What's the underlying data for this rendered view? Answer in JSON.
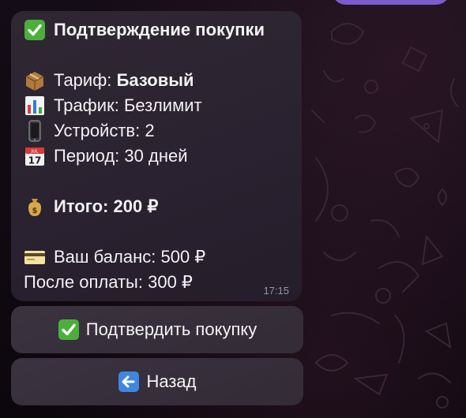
{
  "message": {
    "title_icon": "check-mark-icon",
    "title": "Подтверждение покупки",
    "tariff": {
      "icon": "package-icon",
      "label": "Тариф:",
      "value": "Базовый"
    },
    "traffic": {
      "icon": "bar-chart-icon",
      "label": "Трафик:",
      "value": "Безлимит"
    },
    "devices": {
      "icon": "phone-icon",
      "label": "Устройств:",
      "value": "2"
    },
    "period": {
      "icon": "calendar-icon",
      "label": "Период:",
      "value": "30 дней",
      "calendar_day": "17",
      "calendar_month": "JUL"
    },
    "total": {
      "icon": "money-bag-icon",
      "label": "Итого:",
      "value": "200 ₽"
    },
    "balance": {
      "icon": "credit-card-icon",
      "label": "Ваш баланс:",
      "value": "500 ₽"
    },
    "after_payment": {
      "label": "После оплаты:",
      "value": "300 ₽"
    },
    "time": "17:15"
  },
  "keyboard": {
    "confirm": {
      "icon": "check-mark-icon",
      "label": "Подтвердить покупку"
    },
    "back": {
      "icon": "left-arrow-icon",
      "label": "Назад"
    }
  },
  "colors": {
    "accent": "#7b5ccf",
    "check": "#4caf3c",
    "bubble": "#2c2530",
    "button": "#373039"
  }
}
